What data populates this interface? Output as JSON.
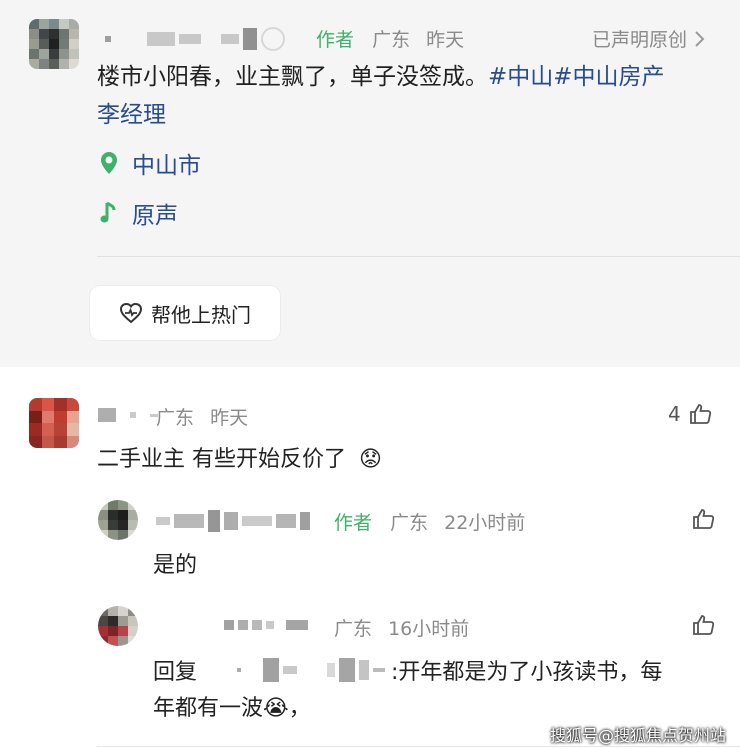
{
  "post": {
    "author_tag": "作者",
    "location": "广东",
    "time": "昨天",
    "original_label": "已声明原创",
    "text_main": "楼市小阳春，业主飘了，单子没签成。",
    "tag1": "#中山",
    "tag2": "#中山房产",
    "tag3": "李经理",
    "location_row": "中山市",
    "sound_row": "原声",
    "hot_button": "帮他上热门"
  },
  "comments": [
    {
      "location": "广东",
      "time": "昨天",
      "text": "二手业主 有些开始反价了",
      "emoji": "😟",
      "likes": "4"
    }
  ],
  "replies": [
    {
      "author_tag": "作者",
      "location": "广东",
      "time": "22小时前",
      "text": "是的"
    },
    {
      "location": "广东",
      "time": "16小时前",
      "reply_prefix": "回复",
      "line1_rest": ":开年都是为了小孩读书，每",
      "line2": "年都有一波",
      "line2_end": "，",
      "emoji": "😭"
    }
  ],
  "watermark": "搜狐号@搜狐焦点贺州站",
  "colors": {
    "author_green": "#3fb26a",
    "link_blue": "#284c8c",
    "post_bg": "#f5f5f5"
  },
  "icons": [
    "location-pin-icon",
    "music-note-icon",
    "heart-pulse-icon",
    "thumbs-up-icon",
    "chevron-right-icon"
  ]
}
